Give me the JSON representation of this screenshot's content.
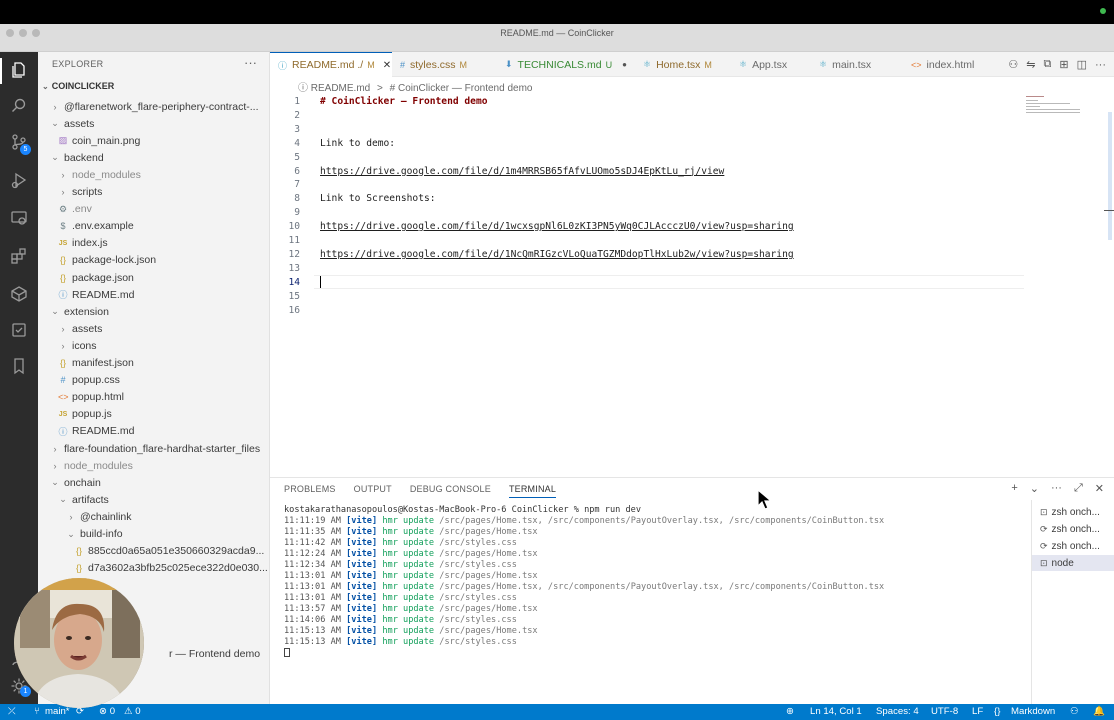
{
  "window": {
    "title": "README.md — CoinClicker"
  },
  "activity_bar": {
    "source_control_badge": "5",
    "accounts_badge": "1"
  },
  "explorer": {
    "header": "EXPLORER",
    "more": "···",
    "project": "COINCLICKER",
    "tree": [
      {
        "label": "@flarenetwork_flare-periphery-contract-...",
        "type": "folder",
        "expanded": false,
        "depth": 0
      },
      {
        "label": "assets",
        "type": "folder",
        "expanded": true,
        "depth": 0
      },
      {
        "label": "coin_main.png",
        "type": "img",
        "depth": 1
      },
      {
        "label": "backend",
        "type": "folder",
        "expanded": true,
        "depth": 0
      },
      {
        "label": "node_modules",
        "type": "folder",
        "expanded": false,
        "depth": 1,
        "dim": true
      },
      {
        "label": "scripts",
        "type": "folder",
        "expanded": false,
        "depth": 1
      },
      {
        "label": ".env",
        "type": "env",
        "depth": 1,
        "dim": true
      },
      {
        "label": ".env.example",
        "type": "env2",
        "depth": 1
      },
      {
        "label": "index.js",
        "type": "js",
        "depth": 1
      },
      {
        "label": "package-lock.json",
        "type": "json",
        "depth": 1
      },
      {
        "label": "package.json",
        "type": "json",
        "depth": 1
      },
      {
        "label": "README.md",
        "type": "md",
        "depth": 1
      },
      {
        "label": "extension",
        "type": "folder",
        "expanded": true,
        "depth": 0
      },
      {
        "label": "assets",
        "type": "folder",
        "expanded": false,
        "depth": 1
      },
      {
        "label": "icons",
        "type": "folder",
        "expanded": false,
        "depth": 1
      },
      {
        "label": "manifest.json",
        "type": "json",
        "depth": 1
      },
      {
        "label": "popup.css",
        "type": "css",
        "depth": 1
      },
      {
        "label": "popup.html",
        "type": "html",
        "depth": 1
      },
      {
        "label": "popup.js",
        "type": "js",
        "depth": 1
      },
      {
        "label": "README.md",
        "type": "md",
        "depth": 1
      },
      {
        "label": "flare-foundation_flare-hardhat-starter_files",
        "type": "folder",
        "expanded": false,
        "depth": 0
      },
      {
        "label": "node_modules",
        "type": "folder",
        "expanded": false,
        "depth": 0,
        "dim": true
      },
      {
        "label": "onchain",
        "type": "folder",
        "expanded": true,
        "depth": 0
      },
      {
        "label": "artifacts",
        "type": "folder",
        "expanded": true,
        "depth": 1
      },
      {
        "label": "@chainlink",
        "type": "folder",
        "expanded": false,
        "depth": 2
      },
      {
        "label": "build-info",
        "type": "folder",
        "expanded": true,
        "depth": 2
      },
      {
        "label": "885ccd0a65a051e350660329acda9...",
        "type": "json",
        "depth": 3
      },
      {
        "label": "d7a3602a3bfb25c025ece322d0e030...",
        "type": "json",
        "depth": 3
      }
    ],
    "overlay_caption": "r — Frontend demo"
  },
  "tabs": [
    {
      "label": "README.md ./",
      "status": "M",
      "icon": "ⓘ",
      "active": true,
      "close": "✕"
    },
    {
      "label": "styles.css",
      "status": "M",
      "icon": "#"
    },
    {
      "label": "TECHNICALS.md",
      "status": "U",
      "icon": "⬇",
      "dirty": true
    },
    {
      "label": "Home.tsx",
      "status": "M",
      "icon": "⚛"
    },
    {
      "label": "App.tsx",
      "status": "",
      "icon": "⚛"
    },
    {
      "label": "main.tsx",
      "status": "",
      "icon": "⚛"
    },
    {
      "label": "index.html",
      "status": "",
      "icon": "<>"
    }
  ],
  "breadcrumb": [
    "ⓘ README.md",
    ">",
    "# CoinClicker — Frontend demo"
  ],
  "editor": {
    "lines": [
      {
        "n": "1",
        "text": "# CoinClicker — Frontend demo",
        "kind": "heading"
      },
      {
        "n": "2",
        "text": "",
        "kind": "plain"
      },
      {
        "n": "3",
        "text": "",
        "kind": "plain"
      },
      {
        "n": "4",
        "text": "Link to demo:",
        "kind": "plain"
      },
      {
        "n": "5",
        "text": "",
        "kind": "plain"
      },
      {
        "n": "6",
        "text": "https://drive.google.com/file/d/1m4MRRSB65fAfvLUOmo5sDJ4EpKtLu_rj/view",
        "kind": "link"
      },
      {
        "n": "7",
        "text": "",
        "kind": "plain"
      },
      {
        "n": "8",
        "text": "Link to Screenshots:",
        "kind": "plain"
      },
      {
        "n": "9",
        "text": "",
        "kind": "plain"
      },
      {
        "n": "10",
        "text": "https://drive.google.com/file/d/1wcxsgpNl6L0zKI3PN5yWq0CJLAccczU0/view?usp=sharing",
        "kind": "link"
      },
      {
        "n": "11",
        "text": "",
        "kind": "plain"
      },
      {
        "n": "12",
        "text": "https://drive.google.com/file/d/1NcQmRIGzcVLoQuaTGZMDdopTlHxLub2w/view?usp=sharing",
        "kind": "link"
      },
      {
        "n": "13",
        "text": "",
        "kind": "plain"
      },
      {
        "n": "14",
        "text": "",
        "kind": "current"
      },
      {
        "n": "15",
        "text": "",
        "kind": "plain"
      },
      {
        "n": "16",
        "text": "",
        "kind": "plain"
      }
    ]
  },
  "panel": {
    "tabs": [
      "PROBLEMS",
      "OUTPUT",
      "DEBUG CONSOLE",
      "TERMINAL"
    ],
    "active_tab": "TERMINAL",
    "actions": [
      "+",
      "⌄",
      "···",
      "⤢",
      "✕"
    ],
    "prompt": "kostakarathanasopoulos@Kostas-MacBook-Pro-6 CoinClicker % npm run dev",
    "log": [
      {
        "time": "11:11:19 AM",
        "paths": "/src/pages/Home.tsx, /src/components/PayoutOverlay.tsx, /src/components/CoinButton.tsx"
      },
      {
        "time": "11:11:35 AM",
        "paths": "/src/pages/Home.tsx"
      },
      {
        "time": "11:11:42 AM",
        "paths": "/src/styles.css"
      },
      {
        "time": "11:12:24 AM",
        "paths": "/src/pages/Home.tsx"
      },
      {
        "time": "11:12:34 AM",
        "paths": "/src/styles.css"
      },
      {
        "time": "11:13:01 AM",
        "paths": "/src/pages/Home.tsx"
      },
      {
        "time": "11:13:01 AM",
        "paths": "/src/pages/Home.tsx, /src/components/PayoutOverlay.tsx, /src/components/CoinButton.tsx"
      },
      {
        "time": "11:13:01 AM",
        "paths": "/src/styles.css"
      },
      {
        "time": "11:13:57 AM",
        "paths": "/src/pages/Home.tsx"
      },
      {
        "time": "11:14:06 AM",
        "paths": "/src/styles.css"
      },
      {
        "time": "11:15:13 AM",
        "paths": "/src/pages/Home.tsx"
      },
      {
        "time": "11:15:13 AM",
        "paths": "/src/styles.css"
      }
    ],
    "vite_tag": "[vite]",
    "hmr_text": "hmr update",
    "terminals": [
      {
        "label": "zsh onch...",
        "icon": "⊡"
      },
      {
        "label": "zsh onch...",
        "icon": "⟳"
      },
      {
        "label": "zsh onch...",
        "icon": "⟳"
      },
      {
        "label": "node",
        "icon": "⊡",
        "active": true
      }
    ]
  },
  "status_bar": {
    "remote": "⤫",
    "branch": "main*",
    "sync": "⟳",
    "errors": "⊗ 0",
    "warnings": "⚠ 0",
    "zoom": "⊕",
    "position": "Ln 14, Col 1",
    "spaces": "Spaces: 4",
    "encoding": "UTF-8",
    "eol": "LF",
    "language": "Markdown",
    "copilot": "⚇",
    "bell": "🔔"
  },
  "colors": {
    "accent": "#007acc",
    "active_tab_border": "#005fb8",
    "heading": "#800000",
    "vite": "#0451a5",
    "hmr": "#14a05c"
  }
}
